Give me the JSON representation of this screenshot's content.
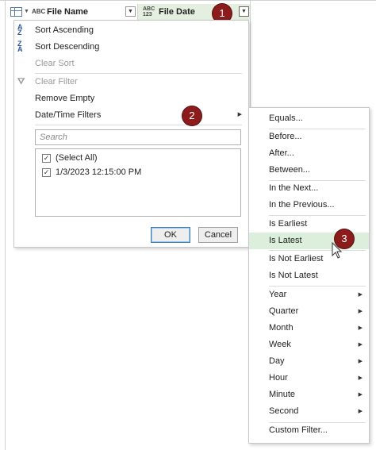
{
  "columns": {
    "file_name": {
      "type_icon": "ABC",
      "title": "File Name"
    },
    "file_date": {
      "type_icon_top": "ABC",
      "type_icon_bottom": "123",
      "title": "File Date"
    }
  },
  "badges": {
    "one": "1",
    "two": "2",
    "three": "3"
  },
  "main_menu": {
    "sort_ascending": "Sort Ascending",
    "sort_descending": "Sort Descending",
    "clear_sort": "Clear Sort",
    "clear_filter": "Clear Filter",
    "remove_empty": "Remove Empty",
    "datetime_filters": "Date/Time Filters",
    "search_placeholder": "Search",
    "checklist": [
      {
        "label": "(Select All)",
        "checked": true
      },
      {
        "label": "1/3/2023 12:15:00 PM",
        "checked": true
      }
    ],
    "ok_label": "OK",
    "cancel_label": "Cancel"
  },
  "sub_menu": {
    "equals": "Equals...",
    "before": "Before...",
    "after": "After...",
    "between": "Between...",
    "in_the_next": "In the Next...",
    "in_the_previous": "In the Previous...",
    "is_earliest": "Is Earliest",
    "is_latest": "Is Latest",
    "is_not_earliest": "Is Not Earliest",
    "is_not_latest": "Is Not Latest",
    "year": "Year",
    "quarter": "Quarter",
    "month": "Month",
    "week": "Week",
    "day": "Day",
    "hour": "Hour",
    "minute": "Minute",
    "second": "Second",
    "custom_filter": "Custom Filter..."
  },
  "colors": {
    "badge": "#8c1c1c",
    "highlight": "#dcefdc",
    "column_header_active": "#e4efe0",
    "icon_blue": "#2b5797"
  },
  "icons": {
    "table": "table-icon",
    "sort_asc": "sort-ascending-icon",
    "sort_desc": "sort-descending-icon",
    "clear_filter": "clear-filter-icon",
    "submenu_arrow": "chevron-right-icon",
    "cursor": "mouse-pointer-icon"
  }
}
